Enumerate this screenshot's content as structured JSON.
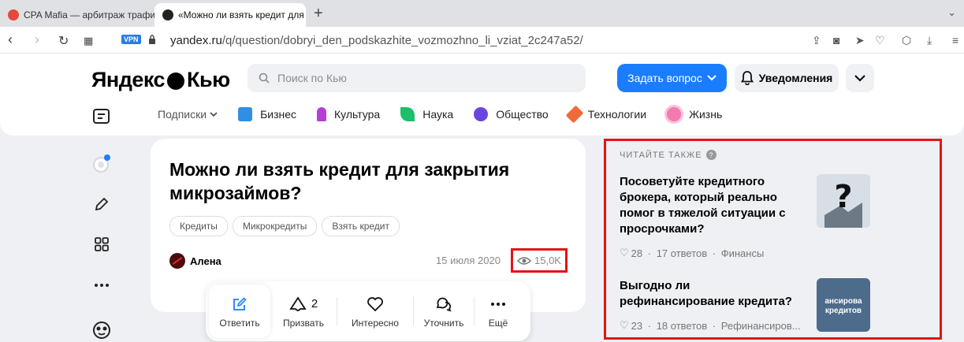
{
  "browser": {
    "tabs": [
      {
        "title": "CPA Mafia — арбитраж трафи"
      },
      {
        "title": "«Можно ли взять кредит для з"
      }
    ],
    "vpn_label": "VPN",
    "url_domain": "yandex.ru",
    "url_path": "/q/question/dobryi_den_podskazhite_vozmozhno_li_vziat_2c247a52/"
  },
  "header": {
    "logo_left": "Яндекс",
    "logo_right": "Кью",
    "search_placeholder": "Поиск по Кью",
    "ask_button": "Задать вопрос",
    "notifications_button": "Уведомления"
  },
  "categories": {
    "subscriptions": "Подписки",
    "items": [
      {
        "label": "Бизнес",
        "color": "#2f8fe6"
      },
      {
        "label": "Культура",
        "color": "#b23fd6"
      },
      {
        "label": "Наука",
        "color": "#1dbf6a"
      },
      {
        "label": "Общество",
        "color": "#6b45e0"
      },
      {
        "label": "Технологии",
        "color": "#f06a3a"
      },
      {
        "label": "Жизнь",
        "color": "#f27ab0"
      }
    ]
  },
  "question": {
    "title": "Можно ли взять кредит для закрытия микрозаймов?",
    "tags": [
      "Кредиты",
      "Микрокредиты",
      "Взять кредит"
    ],
    "author": "Алена",
    "date": "15 июля 2020",
    "views": "15,0K"
  },
  "actions": {
    "answer": "Ответить",
    "summon": "Призвать",
    "summon_count": "2",
    "interesting": "Интересно",
    "clarify": "Уточнить",
    "more": "Ещё"
  },
  "related": {
    "heading": "ЧИТАЙТЕ ТАКЖЕ",
    "items": [
      {
        "title": "Посоветуйте кредитного брокера, который реально помог в тяжелой ситуации с просрочками?",
        "likes": "28",
        "answers": "17 ответов",
        "topic": "Финансы"
      },
      {
        "title": "Выгодно ли рефинансирование кредита?",
        "likes": "23",
        "answers": "18 ответов",
        "topic": "Рефинансиров...",
        "thumb_text": "ансирова кредитов"
      }
    ]
  },
  "colors": {
    "accent": "#1a7dff",
    "highlight": "#e31414"
  }
}
